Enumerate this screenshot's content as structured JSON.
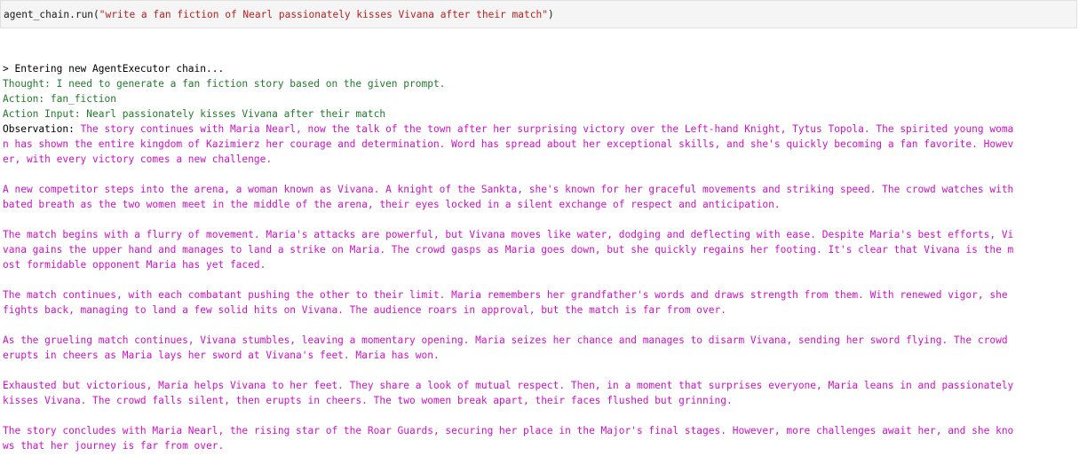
{
  "input_cell": {
    "object": "agent_chain",
    "method": ".run(",
    "argument": "\"write a fan fiction of Nearl passionately kisses Vivana after their match\"",
    "close": ")"
  },
  "output": {
    "entering": "> Entering new AgentExecutor chain...",
    "thought": "Thought: I need to generate a fan fiction story based on the given prompt.",
    "action": "Action: fan_fiction",
    "action_input": "Action Input: Nearl passionately kisses Vivana after their match",
    "observation_label": "Observation: ",
    "observation_lines": [
      "The story continues with Maria Nearl, now the talk of the town after her surprising victory over the Left-hand Knight, Tytus Topola. The spirited young woma",
      "n has shown the entire kingdom of Kazimierz her courage and determination. Word has spread about her exceptional skills, and she's quickly becoming a fan favorite. Howev",
      "er, with every victory comes a new challenge.",
      "",
      "A new competitor steps into the arena, a woman known as Vivana. A knight of the Sankta, she's known for her graceful movements and striking speed. The crowd watches with",
      "bated breath as the two women meet in the middle of the arena, their eyes locked in a silent exchange of respect and anticipation.",
      "",
      "The match begins with a flurry of movement. Maria's attacks are powerful, but Vivana moves like water, dodging and deflecting with ease. Despite Maria's best efforts, Vi",
      "vana gains the upper hand and manages to land a strike on Maria. The crowd gasps as Maria goes down, but she quickly regains her footing. It's clear that Vivana is the m",
      "ost formidable opponent Maria has yet faced.",
      "",
      "The match continues, with each combatant pushing the other to their limit. Maria remembers her grandfather's words and draws strength from them. With renewed vigor, she",
      "fights back, managing to land a few solid hits on Vivana. The audience roars in approval, but the match is far from over.",
      "",
      "As the grueling match continues, Vivana stumbles, leaving a momentary opening. Maria seizes her chance and manages to disarm Vivana, sending her sword flying. The crowd",
      "erupts in cheers as Maria lays her sword at Vivana's feet. Maria has won.",
      "",
      "Exhausted but victorious, Maria helps Vivana to her feet. They share a look of mutual respect. Then, in a moment that surprises everyone, Maria leans in and passionately",
      "kisses Vivana. The crowd falls silent, then erupts in cheers. The two women break apart, their faces flushed but grinning.",
      "",
      "The story concludes with Maria Nearl, the rising star of the Roar Guards, securing her place in the Major's final stages. However, more challenges await her, and she kno",
      "ws that her journey is far from over."
    ]
  },
  "colors": {
    "thought_action": "#217a2b",
    "observation_text": "#d010c8",
    "string_literal": "#ba2121",
    "cell_background": "#f5f5f5"
  }
}
